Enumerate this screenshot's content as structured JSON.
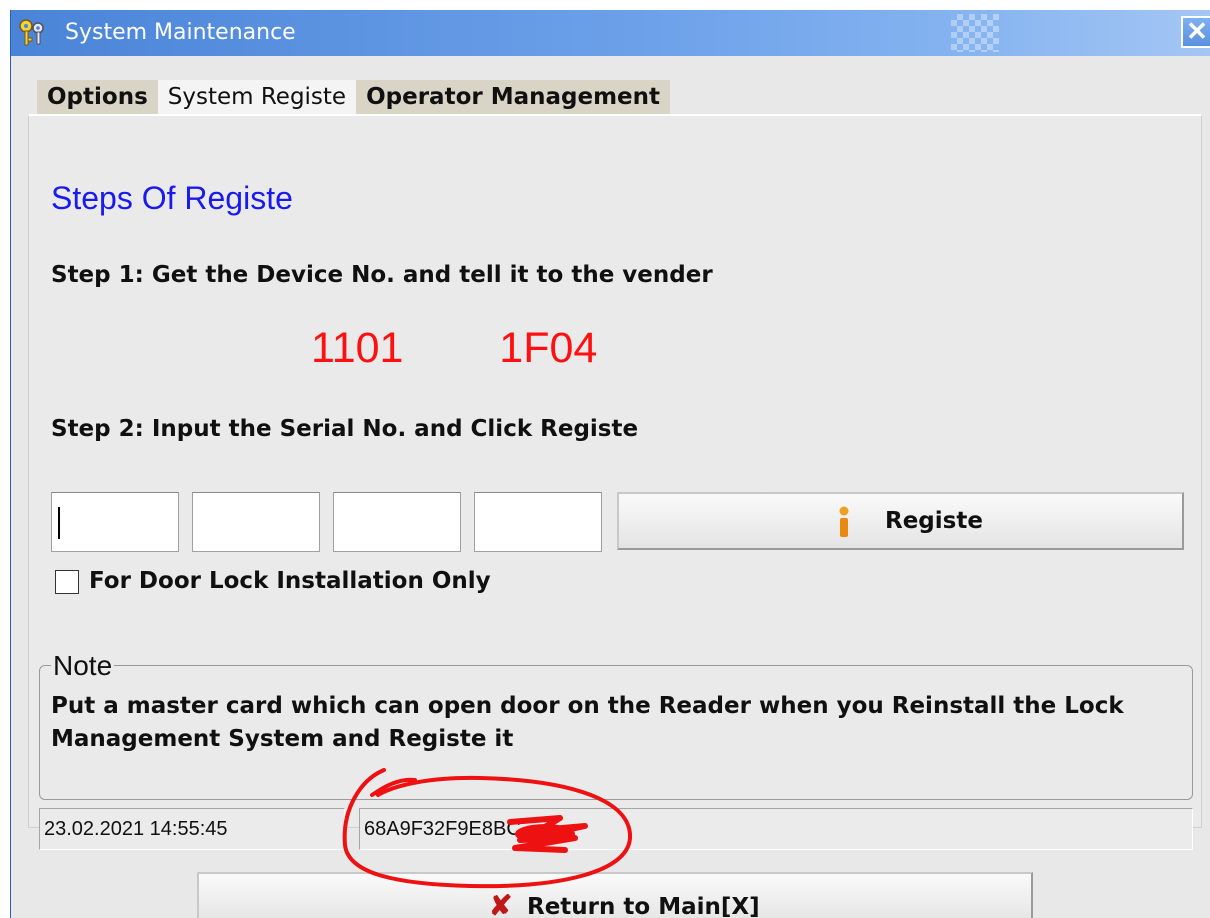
{
  "window": {
    "title": "System Maintenance",
    "close_glyph": "✕"
  },
  "tabs": [
    {
      "label": "Options",
      "active": false
    },
    {
      "label": "System Registe",
      "active": true
    },
    {
      "label": "Operator Management",
      "active": false
    }
  ],
  "register": {
    "heading": "Steps Of Registe",
    "step1": "Step 1: Get the Device No. and tell it to the vender",
    "device_no": "1101   1F04",
    "step2": "Step 2: Input the Serial No. and Click Registe",
    "serial_inputs": [
      "",
      "",
      "",
      ""
    ],
    "registe_button": "Registe",
    "door_lock_checkbox": {
      "label": "For Door Lock Installation Only",
      "checked": false
    }
  },
  "note": {
    "legend": "Note",
    "text": "Put a master card which can open door on the Reader when you Reinstall the Lock Management System and Registe it"
  },
  "status_bar": {
    "datetime": "23.02.2021 14:55:45",
    "code": "68A9F32F9E8BC"
  },
  "return_button": {
    "label": "Return to Main[X]",
    "icon": "x-icon"
  },
  "colors": {
    "heading": "#1a1aee",
    "device_no": "#ff1010",
    "annotation": "#ee1111",
    "title_bar": "#4a84d8"
  }
}
